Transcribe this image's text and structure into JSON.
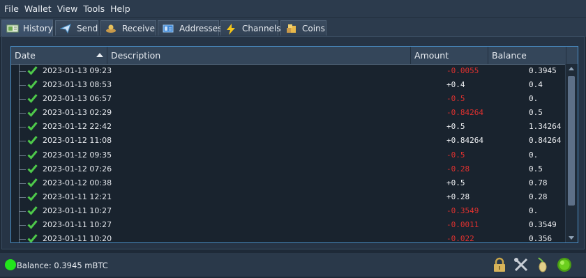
{
  "menu": [
    "File",
    "Wallet",
    "View",
    "Tools",
    "Help"
  ],
  "tabs": [
    {
      "label": "History",
      "icon": "history-icon",
      "active": true
    },
    {
      "label": "Send",
      "icon": "send-icon",
      "active": false
    },
    {
      "label": "Receive",
      "icon": "receive-icon",
      "active": false
    },
    {
      "label": "Addresses",
      "icon": "addresses-icon",
      "active": false
    },
    {
      "label": "Channels",
      "icon": "lightning-icon",
      "active": false
    },
    {
      "label": "Coins",
      "icon": "coins-icon",
      "active": false
    }
  ],
  "table": {
    "headers": {
      "date": "Date",
      "description": "Description",
      "amount": "Amount",
      "balance": "Balance"
    },
    "rows": [
      {
        "date": "2023-01-13 09:23",
        "description": "",
        "amount": "-0.0055",
        "balance": "0.3945"
      },
      {
        "date": "2023-01-13 08:53",
        "description": "",
        "amount": "+0.4",
        "balance": "0.4"
      },
      {
        "date": "2023-01-13 06:57",
        "description": "",
        "amount": "-0.5",
        "balance": "0."
      },
      {
        "date": "2023-01-13 02:29",
        "description": "",
        "amount": "-0.84264",
        "balance": "0.5"
      },
      {
        "date": "2023-01-12 22:42",
        "description": "",
        "amount": "+0.5",
        "balance": "1.34264"
      },
      {
        "date": "2023-01-12 11:08",
        "description": "",
        "amount": "+0.84264",
        "balance": "0.84264"
      },
      {
        "date": "2023-01-12 09:35",
        "description": "",
        "amount": "-0.5",
        "balance": "0."
      },
      {
        "date": "2023-01-12 07:26",
        "description": "",
        "amount": "-0.28",
        "balance": "0.5"
      },
      {
        "date": "2023-01-12 00:38",
        "description": "",
        "amount": "+0.5",
        "balance": "0.78"
      },
      {
        "date": "2023-01-11 12:21",
        "description": "",
        "amount": "+0.28",
        "balance": "0.28"
      },
      {
        "date": "2023-01-11 10:27",
        "description": "",
        "amount": "-0.3549",
        "balance": "0."
      },
      {
        "date": "2023-01-11 10:27",
        "description": "",
        "amount": "-0.0011",
        "balance": "0.3549"
      },
      {
        "date": "2023-01-11 10:20",
        "description": "",
        "amount": "-0.022",
        "balance": "0.356"
      }
    ]
  },
  "status": {
    "balance_text": "Balance: 0.3945 mBTC",
    "icons": [
      "lock-icon",
      "tools-icon",
      "seed-icon",
      "network-status-icon"
    ]
  },
  "colors": {
    "negative": "#e0312f",
    "positive": "#f0f2f5",
    "check": "#4ec94a",
    "accent": "#4a90c8",
    "online": "#22e41c"
  }
}
